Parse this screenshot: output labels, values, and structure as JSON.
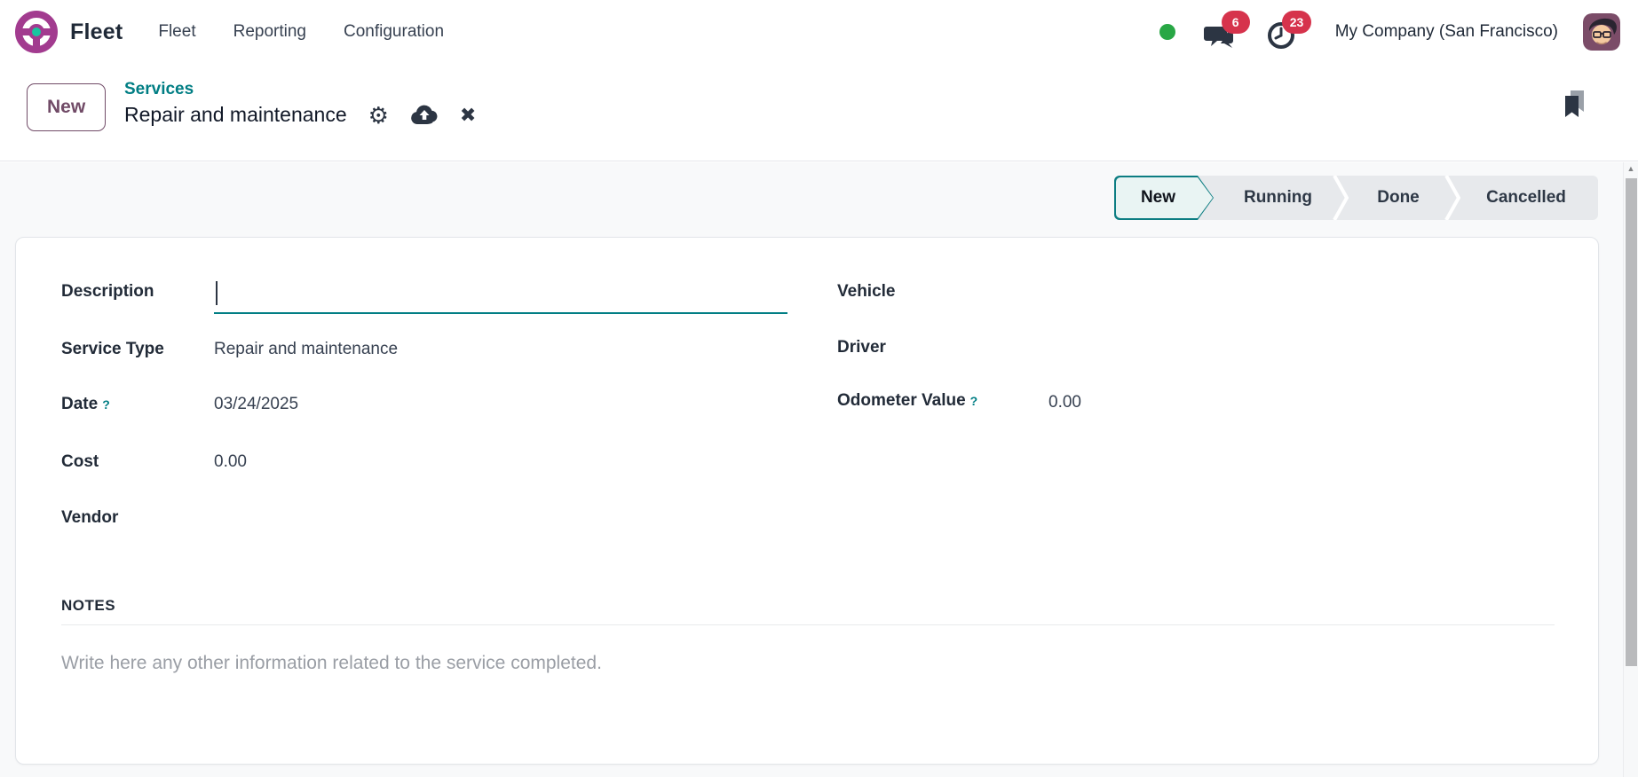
{
  "navbar": {
    "app_name": "Fleet",
    "menus": [
      {
        "label": "Fleet"
      },
      {
        "label": "Reporting"
      },
      {
        "label": "Configuration"
      }
    ],
    "messages_badge": "6",
    "activities_badge": "23",
    "company": "My Company (San Francisco)"
  },
  "breadcrumb": {
    "new_button": "New",
    "parent": "Services",
    "title": "Repair and maintenance"
  },
  "statusbar": {
    "stages": [
      {
        "label": "New",
        "active": true
      },
      {
        "label": "Running",
        "active": false
      },
      {
        "label": "Done",
        "active": false
      },
      {
        "label": "Cancelled",
        "active": false
      }
    ]
  },
  "form": {
    "left": [
      {
        "label": "Description",
        "value": ""
      },
      {
        "label": "Service Type",
        "value": "Repair and maintenance"
      },
      {
        "label": "Date",
        "help": "?",
        "value": "03/24/2025"
      },
      {
        "label": "Cost",
        "value": "0.00"
      },
      {
        "label": "Vendor",
        "value": ""
      }
    ],
    "right": [
      {
        "label": "Vehicle",
        "value": ""
      },
      {
        "label": "Driver",
        "value": ""
      },
      {
        "label": "Odometer Value",
        "help": "?",
        "value": "0.00"
      }
    ],
    "notes": {
      "heading": "NOTES",
      "placeholder": "Write here any other information related to the service completed."
    }
  },
  "colors": {
    "brand_purple": "#714B67",
    "accent_teal": "#017E84",
    "badge_red": "#D6334C",
    "online_green": "#28A745"
  }
}
